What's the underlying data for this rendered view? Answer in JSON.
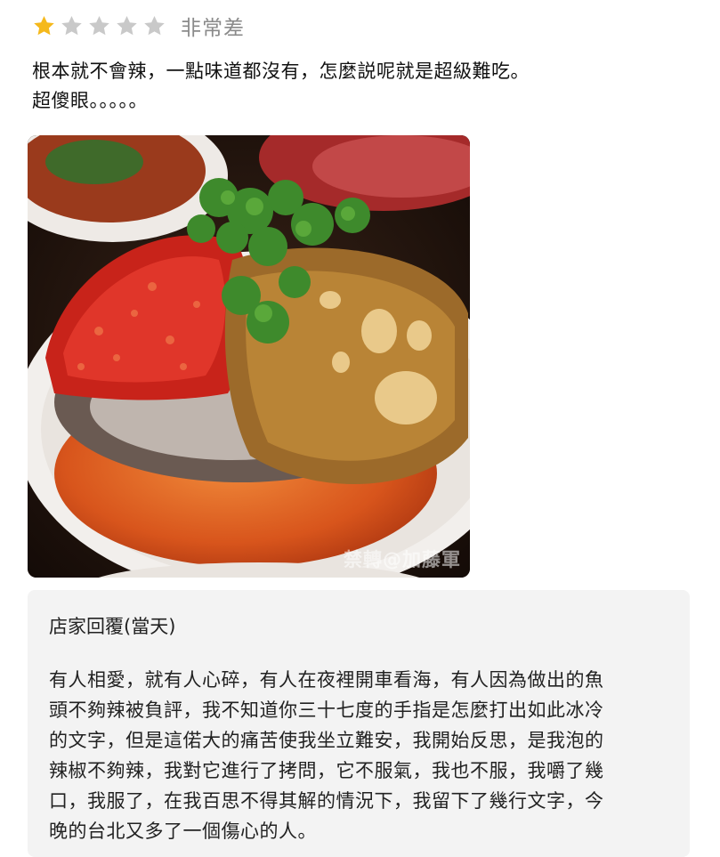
{
  "review": {
    "rating": 1,
    "max_rating": 5,
    "rating_label": "非常差",
    "colors": {
      "star_filled": "#f5b91c",
      "star_empty": "#c9c9c9"
    },
    "text_lines": [
      "根本就不會辣，一點味道都沒有，怎麼説呢就是超級難吃。",
      "超傻眼。。。。。"
    ]
  },
  "photo": {
    "subject": "steamed fish head with chopped chili and pickled peppers",
    "watermark": "禁轉@加藤軍"
  },
  "reply": {
    "title": "店家回覆(當天)",
    "lines": [
      "有人相愛，就有人心碎，有人在夜裡開車看海，有人因為做出的魚",
      "頭不夠辣被負評，我不知道你三十七度的手指是怎麼打出如此冰冷",
      "的文字，但是這偌大的痛苦使我坐立難安，我開始反思，是我泡的",
      "辣椒不夠辣，我對它進行了拷問，它不服氣，我也不服，我嚼了幾",
      "口，我服了，在我百思不得其解的情況下，我留下了幾行文字，今",
      "晚的台北又多了一個傷心的人。"
    ]
  }
}
